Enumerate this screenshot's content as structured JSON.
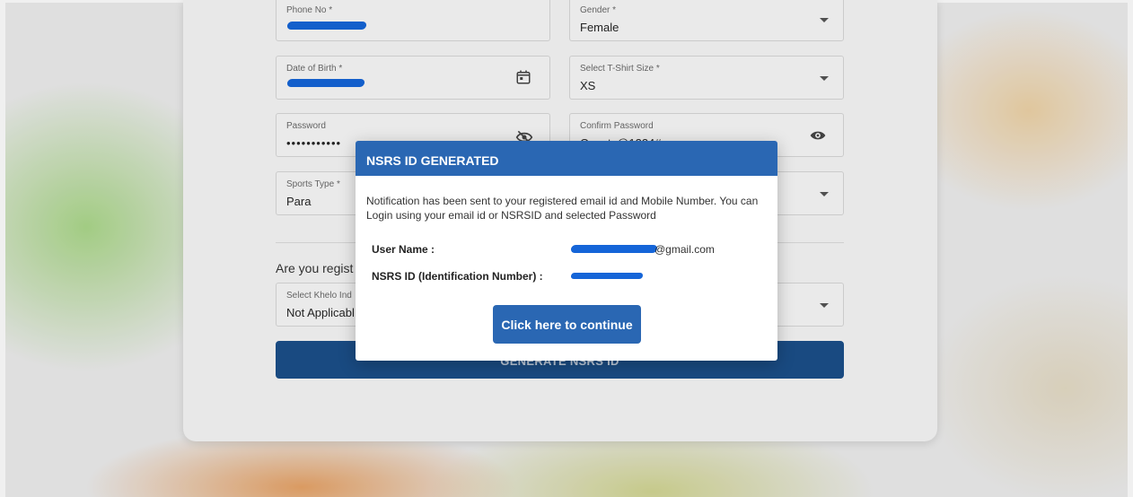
{
  "form": {
    "phone": {
      "label": "Phone No *"
    },
    "gender": {
      "label": "Gender *",
      "value": "Female"
    },
    "dob": {
      "label": "Date of Birth *"
    },
    "tshirt": {
      "label": "Select T-Shirt Size *",
      "value": "XS"
    },
    "password": {
      "label": "Password",
      "value": "•••••••••••"
    },
    "confirm_password": {
      "label": "Confirm Password",
      "value": "Qwerty@1234#"
    },
    "sports_type": {
      "label": "Sports Type *",
      "value": "Para"
    },
    "question": "Are you regist",
    "khelo": {
      "label": "Select Khelo Ind",
      "value": "Not Applicabl"
    },
    "generate_button": "GENERATE NSRS ID"
  },
  "modal": {
    "title": "NSRS ID GENERATED",
    "message": "Notification has been sent to your registered email id and Mobile Number. You can Login using your email id or NSRSID and selected Password",
    "username_label": "User Name :",
    "username_suffix": "@gmail.com",
    "nsrs_label": "NSRS ID (Identification Number) :",
    "continue_button": "Click here to continue"
  },
  "colors": {
    "modal_header": "#2a67b3",
    "primary_button": "#2a67b3",
    "generate_button": "#1b4f8a",
    "redaction": "#1565d8"
  },
  "icons": [
    "calendar-icon",
    "eye-off-icon",
    "eye-icon",
    "chevron-down-icon"
  ]
}
